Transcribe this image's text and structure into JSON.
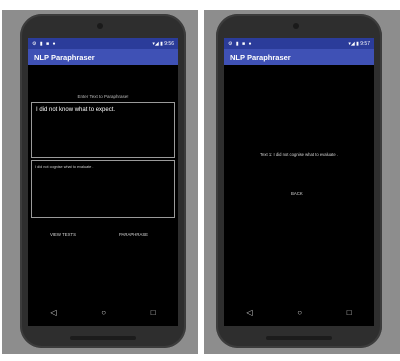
{
  "left": {
    "status": {
      "icons_left": [
        "⚙",
        "▮",
        "■",
        "●"
      ],
      "time": "▾◢ ▮ 9:56"
    },
    "app_title": "NLP Paraphraser",
    "prompt_label": "Enter Text to Paraphrase!",
    "input_text": "I did not know what to expect.",
    "output_text": "I did not cognise what to evaluate .",
    "view_texts_label": "VIEW TEXTS",
    "paraphrase_label": "PARAPHRASE"
  },
  "right": {
    "status": {
      "icons_left": [
        "⚙",
        "▮",
        "■",
        "●"
      ],
      "time": "▾◢ ▮ 9:57"
    },
    "app_title": "NLP Paraphraser",
    "result_text": "Text 1: I did not cognise what to evaluate .",
    "back_label": "BACK"
  },
  "nav": {
    "back_icon": "◁",
    "home_icon": "○",
    "recents_icon": "□"
  },
  "colors": {
    "appbar": "#3f51b5",
    "statusbar": "#2b3c9a",
    "screen_bg": "#000000"
  }
}
